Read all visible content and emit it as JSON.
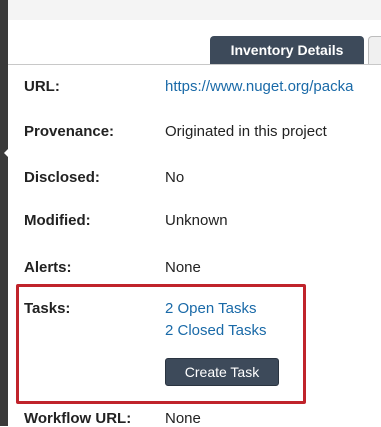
{
  "tabs": {
    "active_label": "Inventory Details"
  },
  "fields": {
    "url_label": "URL:",
    "url_value": "https://www.nuget.org/packa",
    "provenance_label": "Provenance:",
    "provenance_value": "Originated in this project",
    "disclosed_label": "Disclosed:",
    "disclosed_value": "No",
    "modified_label": "Modified:",
    "modified_value": "Unknown",
    "alerts_label": "Alerts:",
    "alerts_value": "None",
    "tasks_label": "Tasks:",
    "open_tasks_link": "2 Open Tasks",
    "closed_tasks_link": "2 Closed Tasks",
    "create_task_button": "Create Task",
    "workflow_label": "Workflow URL:",
    "workflow_value": "None"
  },
  "colors": {
    "tab_active": "#3d4a5a",
    "link": "#1a6aa8",
    "highlight": "#c0232b",
    "button": "#3d4a5a"
  }
}
